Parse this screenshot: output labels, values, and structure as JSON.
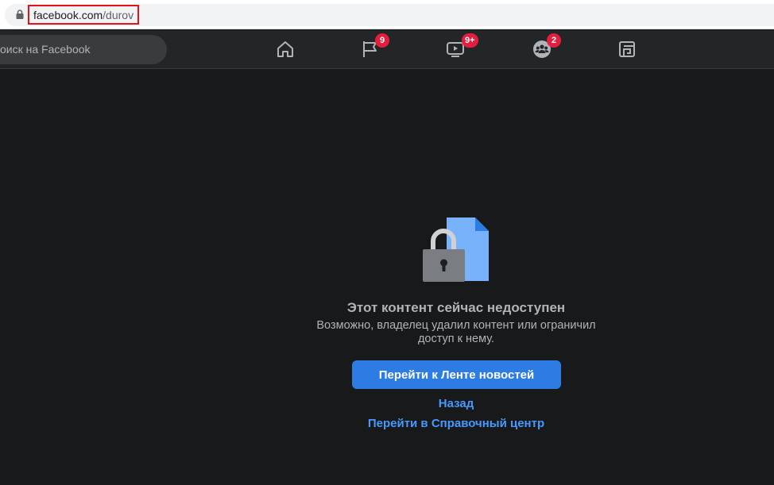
{
  "browser": {
    "url_host": "facebook.com",
    "url_path": "/durov"
  },
  "nav": {
    "search_placeholder": "оиск на Facebook",
    "items": [
      {
        "name": "home",
        "icon": "home-icon",
        "badge": ""
      },
      {
        "name": "pages",
        "icon": "flag-icon",
        "badge": "9"
      },
      {
        "name": "watch",
        "icon": "video-icon",
        "badge": "9+"
      },
      {
        "name": "groups",
        "icon": "groups-icon",
        "badge": "2"
      },
      {
        "name": "gaming",
        "icon": "gaming-icon",
        "badge": ""
      }
    ]
  },
  "message": {
    "title": "Этот контент сейчас недоступен",
    "body": "Возможно, владелец удалил контент или ограничил доступ к нему.",
    "primary_button": "Перейти к Ленте новостей",
    "back_link": "Назад",
    "help_link": "Перейти в Справочный центр"
  },
  "colors": {
    "background": "#18191a",
    "nav_background": "#242526",
    "accent_button": "#2d7ce4",
    "link": "#4599ff",
    "badge": "#e41e3f",
    "url_highlight_border": "#e1141c"
  }
}
